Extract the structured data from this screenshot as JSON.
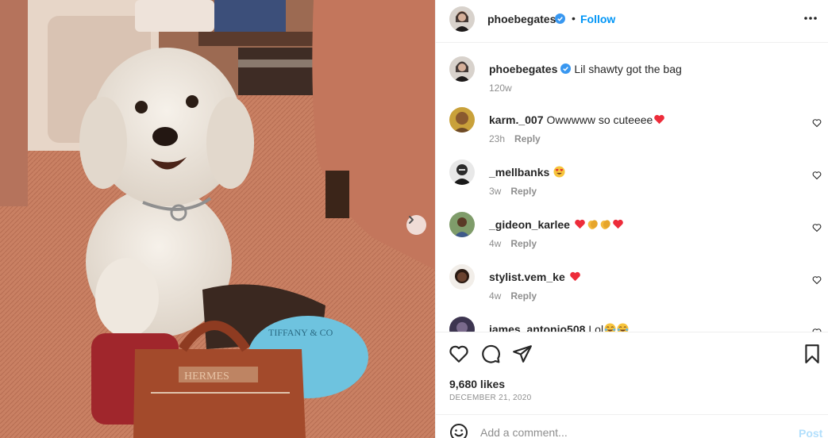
{
  "post": {
    "author": "phoebegates",
    "verified": true,
    "separator": "•",
    "follow_label": "Follow",
    "more_icon": "more-options-icon",
    "caption": "Lil shawty got the bag",
    "caption_time": "120w",
    "likes": "9,680 likes",
    "date": "DECEMBER 21, 2020",
    "image_next_icon": "chevron-right-icon"
  },
  "comments": [
    {
      "user": "karm._007",
      "text": "Owwwww so cuteeee",
      "emojis": [
        "red-heart"
      ],
      "time": "23h",
      "reply": "Reply"
    },
    {
      "user": "_mellbanks",
      "text": "",
      "emojis": [
        "heart-eyes"
      ],
      "time": "3w",
      "reply": "Reply"
    },
    {
      "user": "_gideon_karlee",
      "text": "",
      "emojis": [
        "red-heart",
        "clapping-hands",
        "clapping-hands",
        "red-heart"
      ],
      "time": "4w",
      "reply": "Reply"
    },
    {
      "user": "stylist.vem_ke",
      "text": "",
      "emojis": [
        "red-heart"
      ],
      "time": "4w",
      "reply": "Reply"
    },
    {
      "user": "james_antonio508",
      "text": "Lol",
      "emojis": [
        "tears-of-joy",
        "tears-of-joy"
      ],
      "time": "",
      "reply": ""
    }
  ],
  "actions": {
    "like_icon": "heart-icon",
    "comment_icon": "comment-icon",
    "share_icon": "share-icon",
    "save_icon": "bookmark-icon"
  },
  "compose": {
    "emoji_icon": "smiley-icon",
    "placeholder": "Add a comment...",
    "post_label": "Post"
  },
  "colors": {
    "accent": "#0095f6",
    "verified": "#3897f0",
    "post_disabled": "#b2dffc",
    "heart_red": "#ed2c3a"
  }
}
